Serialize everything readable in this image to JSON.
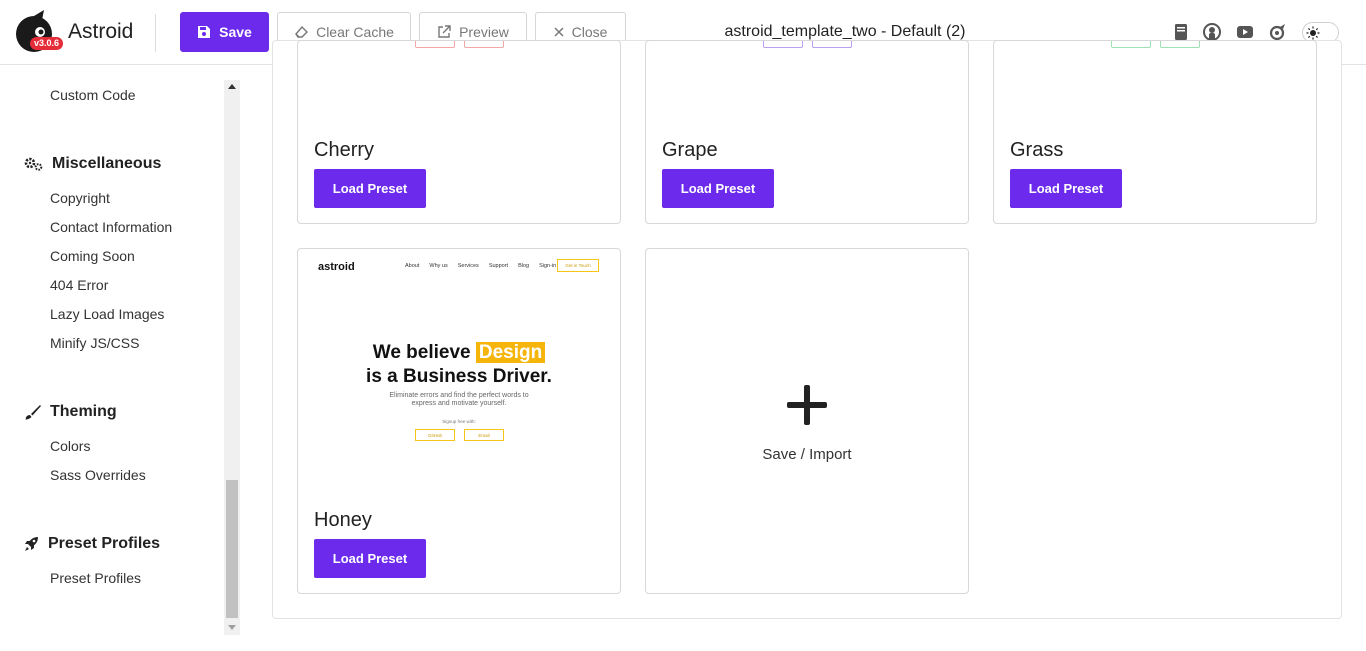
{
  "header": {
    "brand": "Astroid",
    "version": "v3.0.6",
    "save_label": "Save",
    "clear_cache_label": "Clear Cache",
    "preview_label": "Preview",
    "close_label": "Close",
    "document_title": "astroid_template_two - Default (2)",
    "icons": [
      "book-icon",
      "github-icon",
      "youtube-icon",
      "astroid-icon",
      "theme-toggle"
    ]
  },
  "sidebar": {
    "items_top": [
      {
        "label": "Custom Code"
      }
    ],
    "sections": [
      {
        "title": "Miscellaneous",
        "icon": "gears-icon",
        "items": [
          "Copyright",
          "Contact Information",
          "Coming Soon",
          "404 Error",
          "Lazy Load Images",
          "Minify JS/CSS"
        ]
      },
      {
        "title": "Theming",
        "icon": "brush-icon",
        "items": [
          "Colors",
          "Sass Overrides"
        ]
      },
      {
        "title": "Preset Profiles",
        "icon": "rocket-icon",
        "items": [
          "Preset Profiles"
        ]
      }
    ]
  },
  "presets": [
    {
      "name": "Cherry",
      "button": "Load Preset",
      "accent": "#e74c3c"
    },
    {
      "name": "Grape",
      "button": "Load Preset",
      "accent": "#6c2bec"
    },
    {
      "name": "Grass",
      "button": "Load Preset",
      "accent": "#2ecc71"
    },
    {
      "name": "Honey",
      "button": "Load Preset",
      "accent": "#f5b50a"
    }
  ],
  "honey_preview": {
    "logo": "astroid",
    "nav": [
      "About",
      "Why us",
      "Services",
      "Support",
      "Blog",
      "Sign-in"
    ],
    "cta": "Get in Touch",
    "headline_1": "We believe ",
    "headline_highlight": "Design",
    "headline_2": "is a Business Driver.",
    "subtitle_1": "Eliminate errors and find the perfect words to",
    "subtitle_2": "express and motivate yourself.",
    "signup": "Signup free with:",
    "btn_1": "GitHub",
    "btn_2": "Email"
  },
  "save_import": {
    "label": "Save / Import"
  },
  "colors": {
    "primary": "#6c2bec",
    "badge": "#e52d3a"
  }
}
